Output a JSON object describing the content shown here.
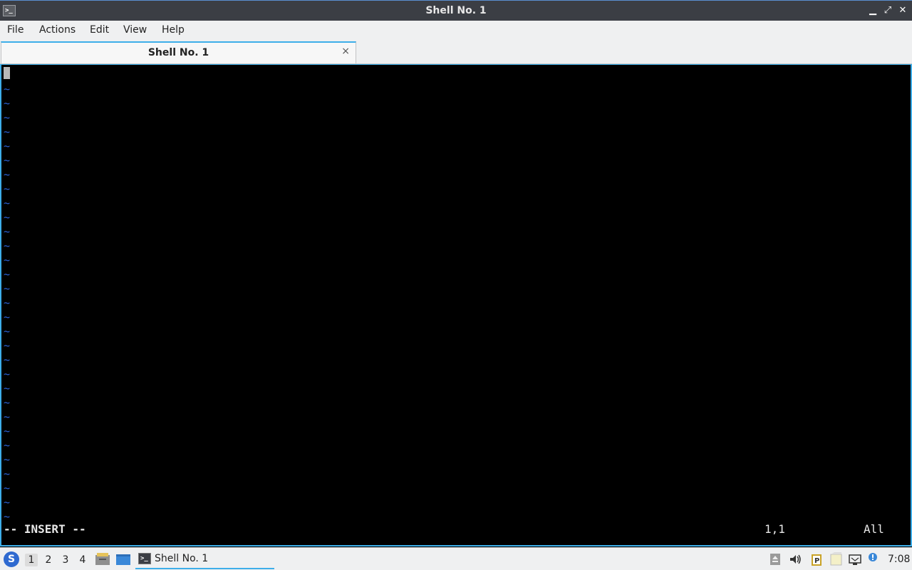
{
  "window": {
    "title": "Shell No. 1",
    "minimize_glyph": "▁",
    "maximize_glyph": "⤢",
    "close_glyph": "✕"
  },
  "menu": [
    "File",
    "Actions",
    "Edit",
    "View",
    "Help"
  ],
  "tab": {
    "label": "Shell No. 1",
    "close_glyph": "×"
  },
  "terminal": {
    "tilde": "~",
    "mode": "-- INSERT --",
    "position": "1,1",
    "scroll": "All"
  },
  "taskbar": {
    "desktops": [
      "1",
      "2",
      "3",
      "4"
    ],
    "active_desktop": "1",
    "task_label": "Shell No. 1",
    "clock": "7:08"
  },
  "colors": {
    "accent": "#3daee9",
    "tilde": "#2a62d8",
    "titlebar": "#3b3e44"
  }
}
